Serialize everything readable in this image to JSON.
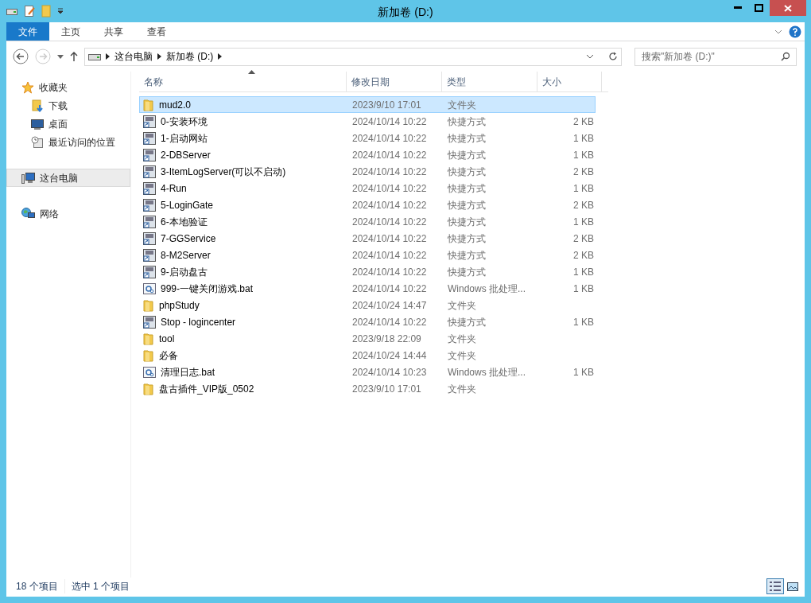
{
  "window": {
    "title": "新加卷 (D:)"
  },
  "ribbon_tabs": [
    {
      "label": "文件",
      "selected": true
    },
    {
      "label": "主页",
      "selected": false
    },
    {
      "label": "共享",
      "selected": false
    },
    {
      "label": "查看",
      "selected": false
    }
  ],
  "address_bar": {
    "path": [
      "这台电脑",
      "新加卷 (D:)"
    ]
  },
  "search": {
    "placeholder": "搜索\"新加卷 (D:)\""
  },
  "sidebar": {
    "items": [
      {
        "label": "收藏夹",
        "kind": "star",
        "selected": false,
        "children": [
          {
            "label": "下载",
            "kind": "download",
            "selected": false
          },
          {
            "label": "桌面",
            "kind": "desktop",
            "selected": false
          },
          {
            "label": "最近访问的位置",
            "kind": "recent",
            "selected": false
          }
        ]
      },
      {
        "label": "这台电脑",
        "kind": "pc",
        "selected": true
      },
      {
        "label": "网络",
        "kind": "network",
        "selected": false
      }
    ]
  },
  "table": {
    "columns": [
      "名称",
      "修改日期",
      "类型",
      "大小"
    ],
    "rows": [
      {
        "name": "mud2.0",
        "date": "2023/9/10 17:01",
        "type": "文件夹",
        "size": "",
        "kind": "folder",
        "selected": true
      },
      {
        "name": "0-安装环境",
        "date": "2024/10/14 10:22",
        "type": "快捷方式",
        "size": "2 KB",
        "kind": "shortcut",
        "selected": false
      },
      {
        "name": "1-启动网站",
        "date": "2024/10/14 10:22",
        "type": "快捷方式",
        "size": "1 KB",
        "kind": "shortcut",
        "selected": false
      },
      {
        "name": "2-DBServer",
        "date": "2024/10/14 10:22",
        "type": "快捷方式",
        "size": "1 KB",
        "kind": "shortcut",
        "selected": false
      },
      {
        "name": "3-ItemLogServer(可以不启动)",
        "date": "2024/10/14 10:22",
        "type": "快捷方式",
        "size": "2 KB",
        "kind": "shortcut",
        "selected": false
      },
      {
        "name": "4-Run",
        "date": "2024/10/14 10:22",
        "type": "快捷方式",
        "size": "1 KB",
        "kind": "shortcut",
        "selected": false
      },
      {
        "name": "5-LoginGate",
        "date": "2024/10/14 10:22",
        "type": "快捷方式",
        "size": "2 KB",
        "kind": "shortcut",
        "selected": false
      },
      {
        "name": "6-本地验证",
        "date": "2024/10/14 10:22",
        "type": "快捷方式",
        "size": "1 KB",
        "kind": "shortcut",
        "selected": false
      },
      {
        "name": "7-GGService",
        "date": "2024/10/14 10:22",
        "type": "快捷方式",
        "size": "2 KB",
        "kind": "shortcut",
        "selected": false
      },
      {
        "name": "8-M2Server",
        "date": "2024/10/14 10:22",
        "type": "快捷方式",
        "size": "2 KB",
        "kind": "shortcut",
        "selected": false
      },
      {
        "name": "9-启动盘古",
        "date": "2024/10/14 10:22",
        "type": "快捷方式",
        "size": "1 KB",
        "kind": "shortcut",
        "selected": false
      },
      {
        "name": "999-一键关闭游戏.bat",
        "date": "2024/10/14 10:22",
        "type": "Windows 批处理...",
        "size": "1 KB",
        "kind": "batch",
        "selected": false
      },
      {
        "name": "phpStudy",
        "date": "2024/10/24 14:47",
        "type": "文件夹",
        "size": "",
        "kind": "folder",
        "selected": false
      },
      {
        "name": "Stop - logincenter",
        "date": "2024/10/14 10:22",
        "type": "快捷方式",
        "size": "1 KB",
        "kind": "shortcut",
        "selected": false
      },
      {
        "name": "tool",
        "date": "2023/9/18 22:09",
        "type": "文件夹",
        "size": "",
        "kind": "folder",
        "selected": false
      },
      {
        "name": "必备",
        "date": "2024/10/24 14:44",
        "type": "文件夹",
        "size": "",
        "kind": "folder",
        "selected": false
      },
      {
        "name": "清理日志.bat",
        "date": "2024/10/14 10:23",
        "type": "Windows 批处理...",
        "size": "1 KB",
        "kind": "batch",
        "selected": false
      },
      {
        "name": "盘古插件_VIP版_0502",
        "date": "2023/9/10 17:01",
        "type": "文件夹",
        "size": "",
        "kind": "folder",
        "selected": false
      }
    ]
  },
  "status_bar": {
    "item_count": "18 个项目",
    "selection": "选中 1 个项目"
  }
}
